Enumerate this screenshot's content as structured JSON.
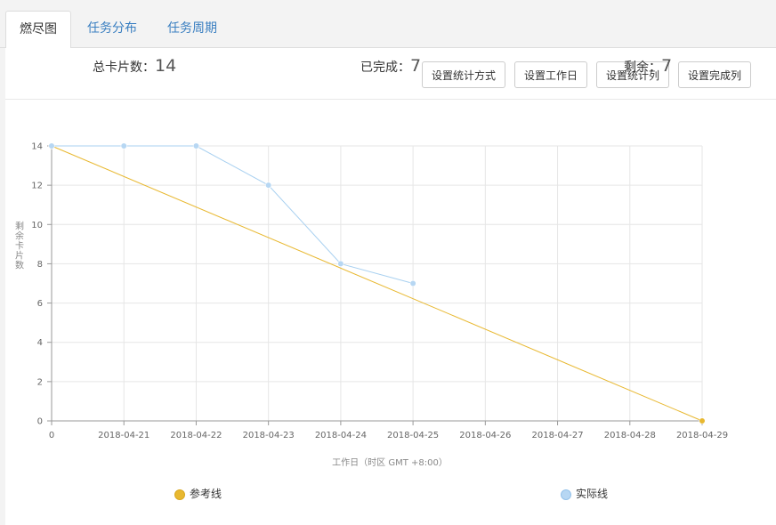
{
  "tabs": [
    {
      "label": "燃尽图",
      "active": true
    },
    {
      "label": "任务分布",
      "active": false
    },
    {
      "label": "任务周期",
      "active": false
    }
  ],
  "toolbar": {
    "buttons": [
      "设置统计方式",
      "设置工作日",
      "设置统计列",
      "设置完成列"
    ]
  },
  "stats": {
    "total_label": "总卡片数：",
    "total_value": "14",
    "done_label": "已完成：",
    "done_value": "7",
    "remain_label": "剩余：",
    "remain_value": "7"
  },
  "colors": {
    "reference": "#e8b830",
    "actual": "#a8d0f0",
    "actual_fill": "#b7d7f3",
    "tab_link": "#3a7fc1"
  },
  "chart_data": {
    "type": "line",
    "x": [
      "0",
      "2018-04-21",
      "2018-04-22",
      "2018-04-23",
      "2018-04-24",
      "2018-04-25",
      "2018-04-26",
      "2018-04-27",
      "2018-04-28",
      "2018-04-29"
    ],
    "xlabel": "工作日（时区 GMT +8:00）",
    "ylabel": "剩余卡片数",
    "ylim": [
      0,
      14
    ],
    "yticks": [
      0,
      2,
      4,
      6,
      8,
      10,
      12,
      14
    ],
    "grid": true,
    "legend": "bottom",
    "series": [
      {
        "name": "参考线",
        "values": [
          14,
          null,
          null,
          null,
          null,
          null,
          null,
          null,
          null,
          0
        ]
      },
      {
        "name": "实际线",
        "values": [
          14,
          14,
          14,
          12,
          8,
          7,
          null,
          null,
          null,
          null
        ]
      }
    ]
  }
}
